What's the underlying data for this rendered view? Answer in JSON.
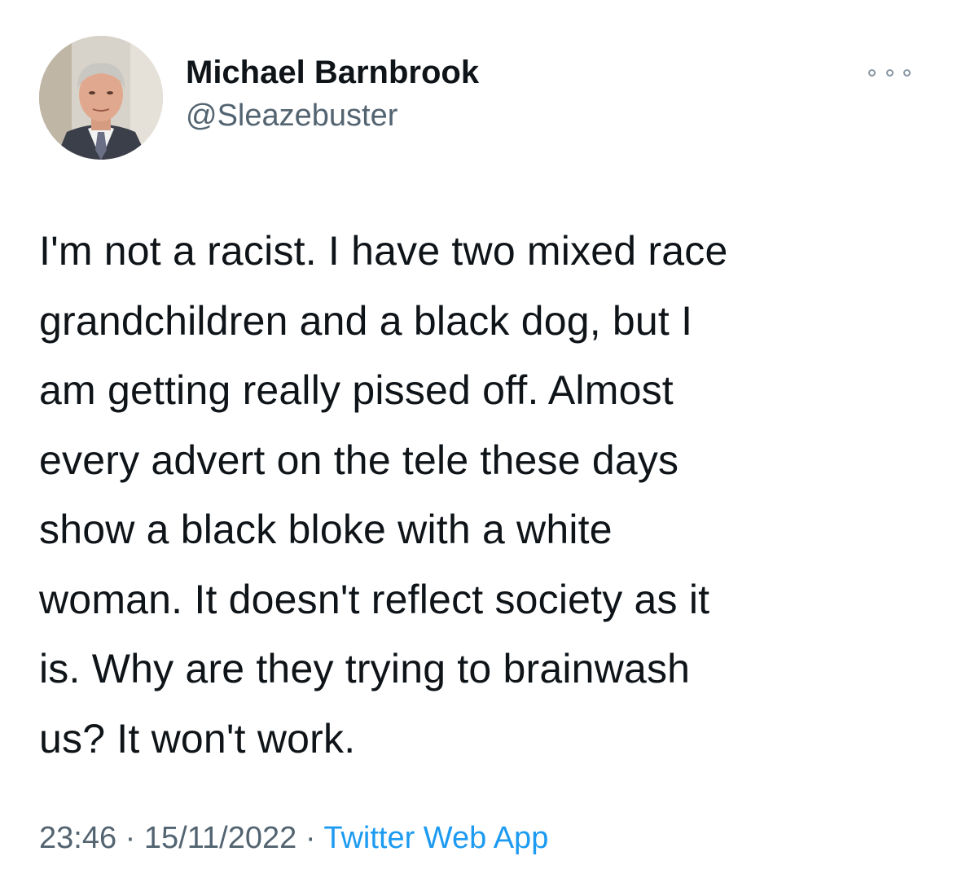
{
  "tweet": {
    "author": {
      "display_name": "Michael Barnbrook",
      "handle": "@Sleazebuster"
    },
    "more_icon": "more-horizontal-icon",
    "text_lines": [
      "I'm not a racist. I have two mixed race",
      "grandchildren and a black dog, but I",
      "am getting really pissed off. Almost",
      "every advert on the tele these days",
      "show a black bloke with a white",
      "woman. It doesn't reflect society as it",
      "is. Why are they trying to brainwash",
      "us? It won't work."
    ],
    "time": "23:46",
    "separator": "·",
    "date": "15/11/2022",
    "source": "Twitter Web App"
  },
  "colors": {
    "text": "#0f1419",
    "secondary": "#536471",
    "link": "#1d9bf0"
  }
}
